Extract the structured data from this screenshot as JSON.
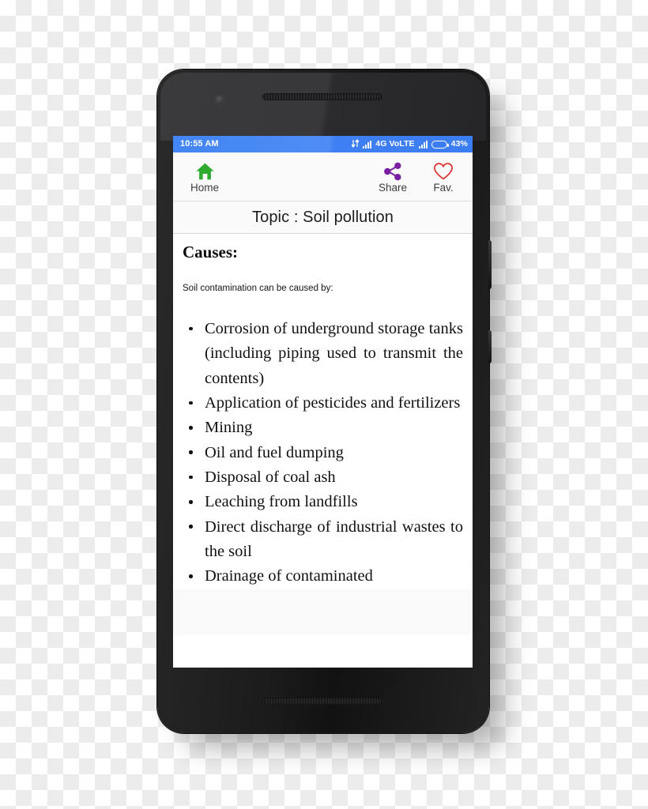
{
  "status_bar": {
    "time": "10:55 AM",
    "network_label": "4G VoLTE",
    "battery_percent": "43%",
    "battery_level": 43,
    "sync_icon": "sync-arrows-icon",
    "signal_icon": "signal-bars-icon",
    "background_color": "#4285f4"
  },
  "toolbar": {
    "home": {
      "label": "Home",
      "icon": "home-icon",
      "color": "#2eaa2e"
    },
    "share": {
      "label": "Share",
      "icon": "share-icon",
      "color": "#7b1fa2"
    },
    "fav": {
      "label": "Fav.",
      "icon": "heart-outline-icon",
      "color": "#e03030"
    }
  },
  "topic": {
    "title": "Topic : Soil pollution"
  },
  "content": {
    "heading": "Causes:",
    "intro": "Soil contamination can be caused by:",
    "bullets": [
      "Corrosion of underground storage tanks (including piping used to transmit the contents)",
      "Application of pesticides and fertilizers",
      "Mining",
      "Oil and fuel dumping",
      "Disposal of coal ash",
      "Leaching from landfills",
      "Direct discharge of industrial wastes to the soil",
      "Drainage of contaminated"
    ]
  },
  "device": {
    "frame_color": "#1b1b1b",
    "camera_icon": "front-camera-icon",
    "earpiece_icon": "earpiece-speaker-icon",
    "bottom_speaker_icon": "bottom-speaker-icon"
  }
}
